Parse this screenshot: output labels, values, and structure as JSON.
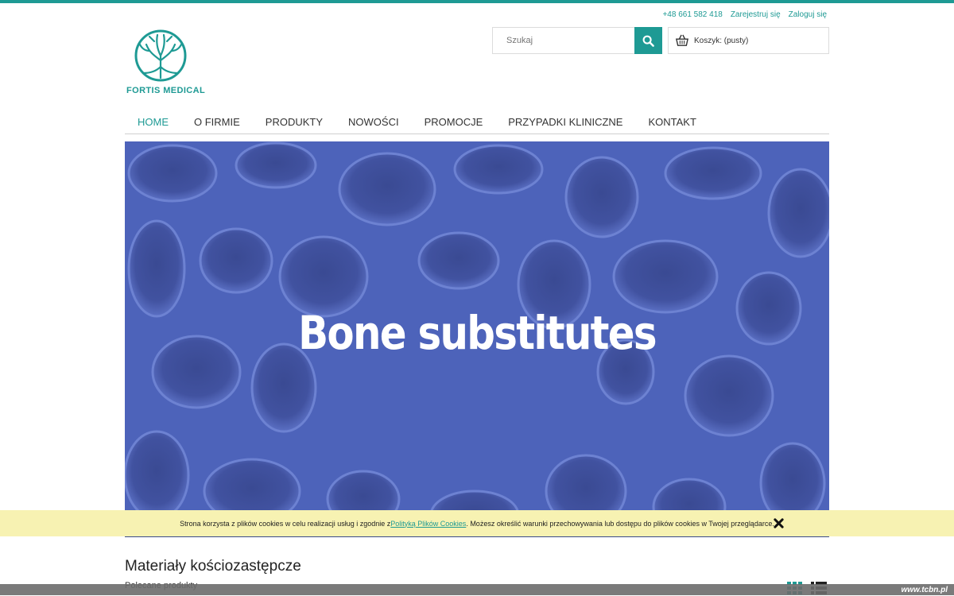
{
  "header": {
    "phone": "+48 661 582 418",
    "register": "Zarejestruj się",
    "login": "Zaloguj się",
    "brand": "FORTIS MEDICAL",
    "search_placeholder": "Szukaj",
    "cart_label": "Koszyk: (pusty)",
    "accent_color": "#1e9a94"
  },
  "nav": {
    "items": [
      "HOME",
      "O FIRMIE",
      "PRODUKTY",
      "NOWOŚCI",
      "PROMOCJE",
      "PRZYPADKI KLINICZNE",
      "KONTAKT"
    ],
    "active": "HOME"
  },
  "hero": {
    "title": "Bone substitutes",
    "background_color": "#4a5fb6"
  },
  "cookie": {
    "text_before": "Strona korzysta z plików cookies w celu realizacji usług i zgodnie z ",
    "link": "Polityką Plików Cookies",
    "text_after": ". Możesz określić warunki przechowywania lub dostępu do plików cookies w Twojej przeglądarce."
  },
  "main": {
    "title": "Materiały kościozastępcze",
    "subtitle": "Polecane produkty"
  },
  "watermark": "www.tcbn.pl"
}
